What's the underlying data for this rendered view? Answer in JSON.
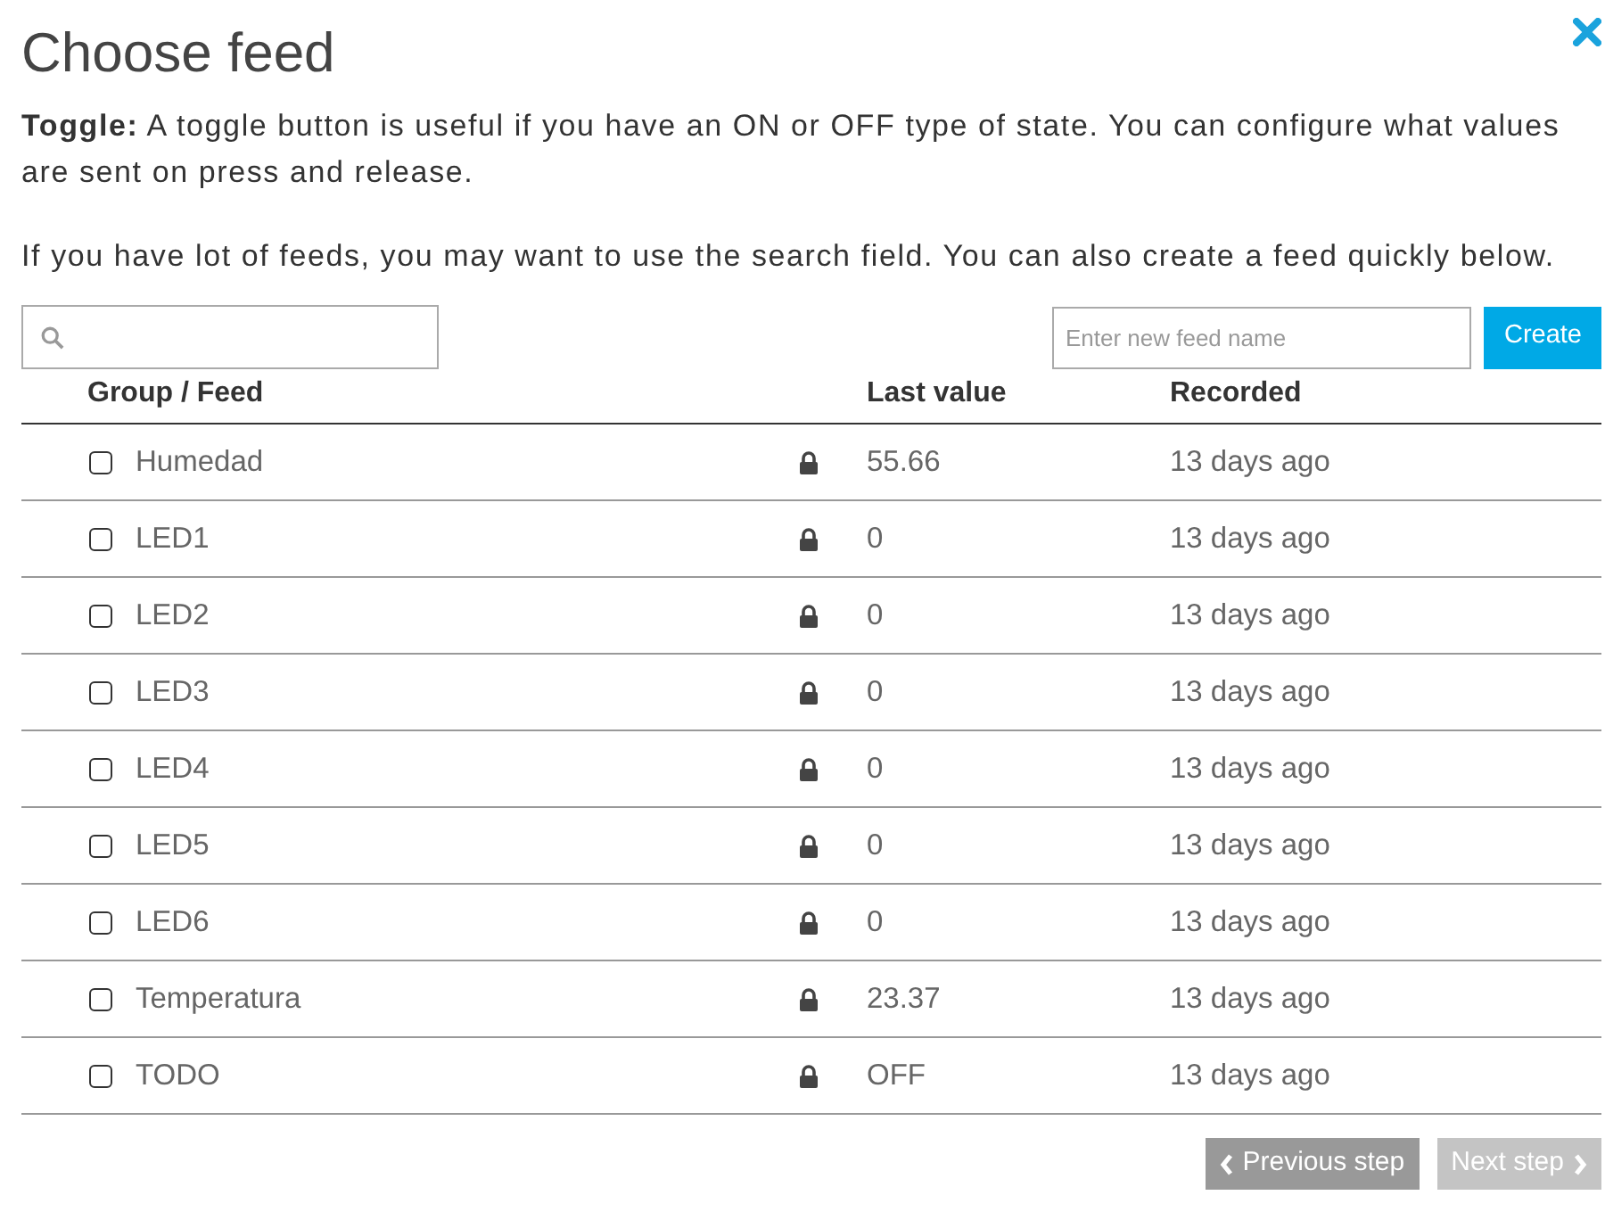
{
  "title": "Choose feed",
  "description": "**Toggle:** A toggle button is useful if you have an ON or OFF type of state. You can configure what values are sent on press and release.",
  "hint": "If you have lot of feeds, you may want to use the search field. You can also create a feed quickly below.",
  "new_feed": {
    "placeholder": "Enter new feed name",
    "button": "Create"
  },
  "table": {
    "columns": [
      "Group / Feed",
      "Last value",
      "Recorded"
    ],
    "rows": [
      {
        "name": "Humedad",
        "checked": false,
        "locked": true,
        "last_value": "55.66",
        "recorded": "13 days ago"
      },
      {
        "name": "LED1",
        "checked": false,
        "locked": true,
        "last_value": "0",
        "recorded": "13 days ago"
      },
      {
        "name": "LED2",
        "checked": false,
        "locked": true,
        "last_value": "0",
        "recorded": "13 days ago"
      },
      {
        "name": "LED3",
        "checked": false,
        "locked": true,
        "last_value": "0",
        "recorded": "13 days ago"
      },
      {
        "name": "LED4",
        "checked": false,
        "locked": true,
        "last_value": "0",
        "recorded": "13 days ago"
      },
      {
        "name": "LED5",
        "checked": false,
        "locked": true,
        "last_value": "0",
        "recorded": "13 days ago"
      },
      {
        "name": "LED6",
        "checked": false,
        "locked": true,
        "last_value": "0",
        "recorded": "13 days ago"
      },
      {
        "name": "Temperatura",
        "checked": false,
        "locked": true,
        "last_value": "23.37",
        "recorded": "13 days ago"
      },
      {
        "name": "TODO",
        "checked": false,
        "locked": true,
        "last_value": "OFF",
        "recorded": "13 days ago"
      }
    ]
  },
  "buttons": [
    {
      "label": "Previous step",
      "disabled": false
    },
    {
      "label": "Next step",
      "disabled": true
    }
  ]
}
